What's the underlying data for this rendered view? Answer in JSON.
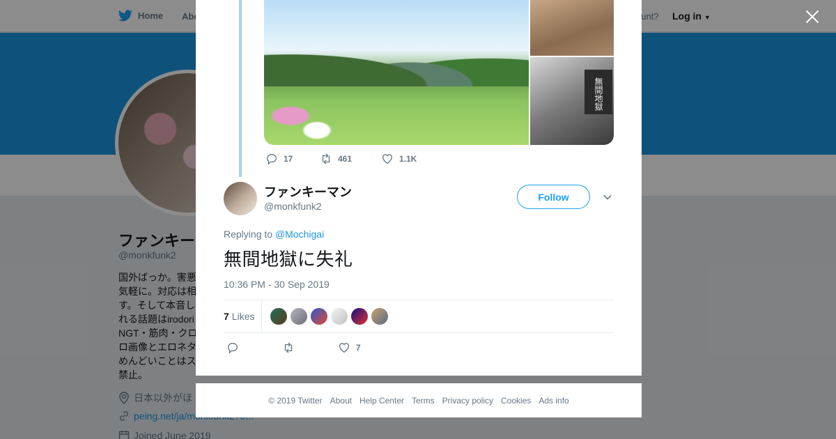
{
  "topnav": {
    "home": "Home",
    "about": "Abo",
    "account": "ccount?",
    "login": "Log in"
  },
  "profile": {
    "name": "ファンキー",
    "handle": "@monkfunk2",
    "bio": "国外ばっか。害悪\n気軽に。対応は相\nす。そして本音し\nれる話題はirodori\nNGT・筋肉・クロ\nロ画像とエロネタ\nめんどいことはス\n禁止。",
    "location": "日本以外がほ",
    "website": "peing.net/ja/monkfunk2?e...",
    "joined": "Joined June 2019"
  },
  "prev_tweet": {
    "sign_text": "無間地獄",
    "replies": "17",
    "retweets": "461",
    "likes": "1.1K"
  },
  "tweet": {
    "author_name": "ファンキーマン",
    "author_handle": "@monkfunk2",
    "follow_label": "Follow",
    "replying_prefix": "Replying to",
    "replying_to": "@Mochigai",
    "text": "無間地獄に失礼",
    "timestamp": "10:36 PM - 30 Sep 2019",
    "likes_count": "7",
    "likes_label": "Likes",
    "like_action_count": "7"
  },
  "likers": [
    {
      "colors": [
        "#1f6f5a",
        "#5a3a1c"
      ]
    },
    {
      "colors": [
        "#b5b5bd",
        "#6e6e78"
      ]
    },
    {
      "colors": [
        "#2a58d8",
        "#e04a2a"
      ]
    },
    {
      "colors": [
        "#f5f5f5",
        "#c0c0c0"
      ]
    },
    {
      "colors": [
        "#101080",
        "#e03030"
      ]
    },
    {
      "colors": [
        "#c8a070",
        "#5a6a80"
      ]
    }
  ],
  "footer": [
    "© 2019 Twitter",
    "About",
    "Help Center",
    "Terms",
    "Privacy policy",
    "Cookies",
    "Ads info"
  ],
  "colors": {
    "accent": "#1da1f2",
    "banner": "#1b95e0",
    "thread": "#a6d4f2"
  },
  "icons": [
    "twitter-bird-icon",
    "close-icon",
    "reply-icon",
    "retweet-icon",
    "heart-icon",
    "chevron-down-icon",
    "location-icon",
    "link-icon",
    "calendar-icon"
  ]
}
